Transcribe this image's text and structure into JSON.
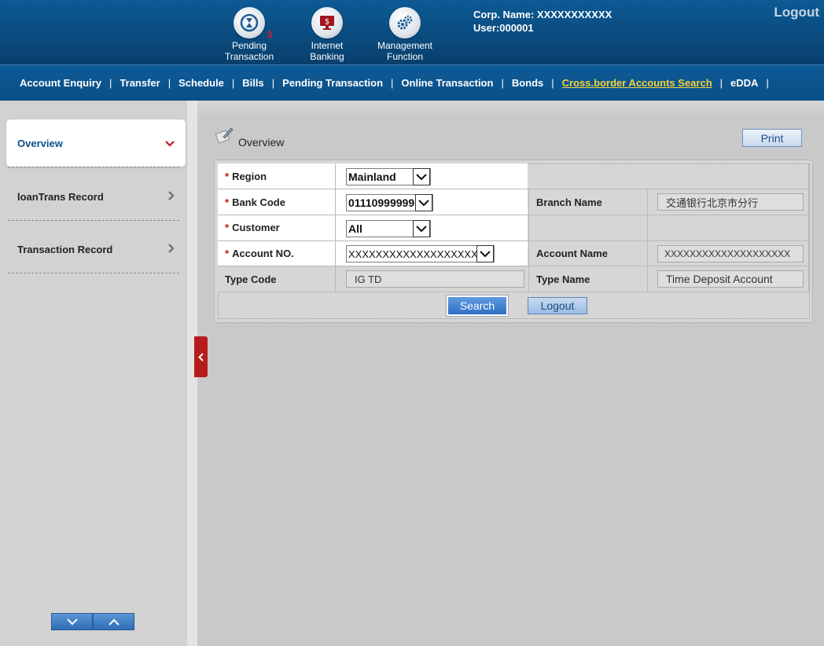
{
  "header": {
    "icons": [
      {
        "label_line1": "Pending",
        "label_line2": "Transaction",
        "badge": "3",
        "icon": "hourglass-refresh-icon"
      },
      {
        "label_line1": "Internet",
        "label_line2": "Banking",
        "icon": "monitor-dollar-icon"
      },
      {
        "label_line1": "Management",
        "label_line2": "Function",
        "icon": "gears-icon"
      }
    ],
    "corp_name": "Corp. Name: XXXXXXXXXXX",
    "user": "User:000001",
    "logout": "Logout"
  },
  "nav": {
    "items": [
      {
        "label": "Account Enquiry"
      },
      {
        "label": "Transfer"
      },
      {
        "label": "Schedule"
      },
      {
        "label": "Bills"
      },
      {
        "label": "Pending Transaction"
      },
      {
        "label": "Online Transaction"
      },
      {
        "label": "Bonds"
      },
      {
        "label": "Cross.border Accounts Search",
        "active": true
      },
      {
        "label": "eDDA"
      }
    ],
    "separator": "|"
  },
  "sidebar": {
    "items": [
      {
        "label": "Overview",
        "active": true
      },
      {
        "label": "loanTrans Record"
      },
      {
        "label": "Transaction Record"
      }
    ]
  },
  "main": {
    "title": "Overview",
    "print": "Print",
    "form": {
      "region_label": "Region",
      "region_value": "Mainland",
      "bank_code_label": "Bank Code",
      "bank_code_value": "01110999999",
      "branch_name_label": "Branch Name",
      "branch_name_value": "交通银行北京市分行",
      "customer_label": "Customer",
      "customer_value": "All",
      "account_no_label": "Account NO.",
      "account_no_value": "XXXXXXXXXXXXXXXXXXXX",
      "account_name_label": "Account Name",
      "account_name_value": "XXXXXXXXXXXXXXXXXXXX",
      "type_code_label": "Type Code",
      "type_code_value": "IG TD",
      "type_name_label": "Type Name",
      "type_name_value": "Time Deposit Account",
      "required_mark": "*"
    },
    "search": "Search",
    "logout": "Logout"
  },
  "colors": {
    "header": "#0a4c80",
    "nav_active": "#f2d43a",
    "required": "#c0171c",
    "search_button": "#2f6fc4",
    "collapse_tab": "#b71c1c"
  }
}
